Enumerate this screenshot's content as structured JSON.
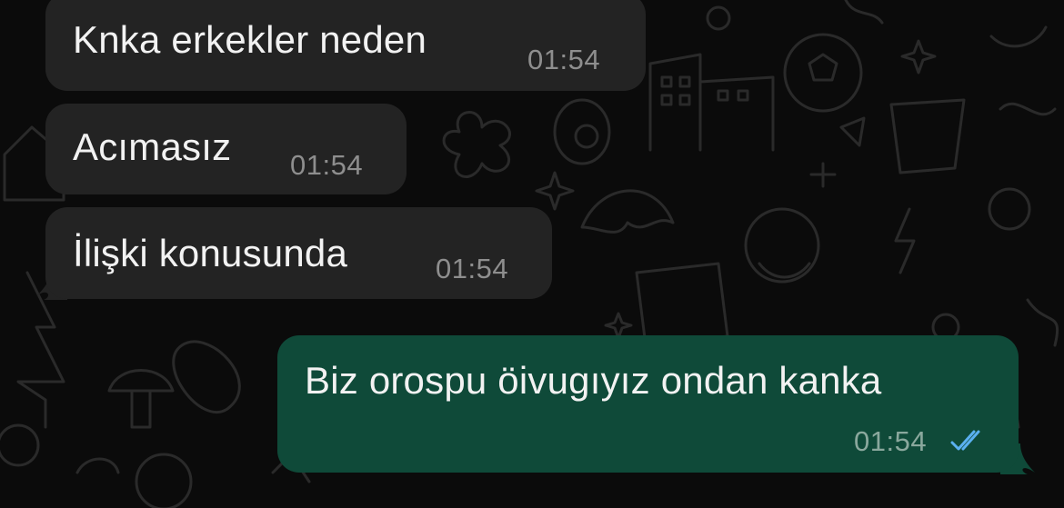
{
  "chat": {
    "messages": [
      {
        "direction": "incoming",
        "text": "Knka erkekler neden",
        "time": "01:54"
      },
      {
        "direction": "incoming",
        "text": "Acımasız",
        "time": "01:54"
      },
      {
        "direction": "incoming",
        "text": "İlişki konusunda",
        "time": "01:54"
      },
      {
        "direction": "outgoing",
        "text": "Biz orospu öivugıyız ondan kanka",
        "time": "01:54",
        "status": "read"
      }
    ]
  },
  "colors": {
    "background": "#0b0b0b",
    "incoming_bubble": "#232323",
    "outgoing_bubble": "#0f4a39",
    "timestamp": "#8e8e8e",
    "read_ticks": "#5ab0f0"
  },
  "icons": {
    "read_receipt": "double-check-icon",
    "wallpaper": "doodle-pattern"
  }
}
